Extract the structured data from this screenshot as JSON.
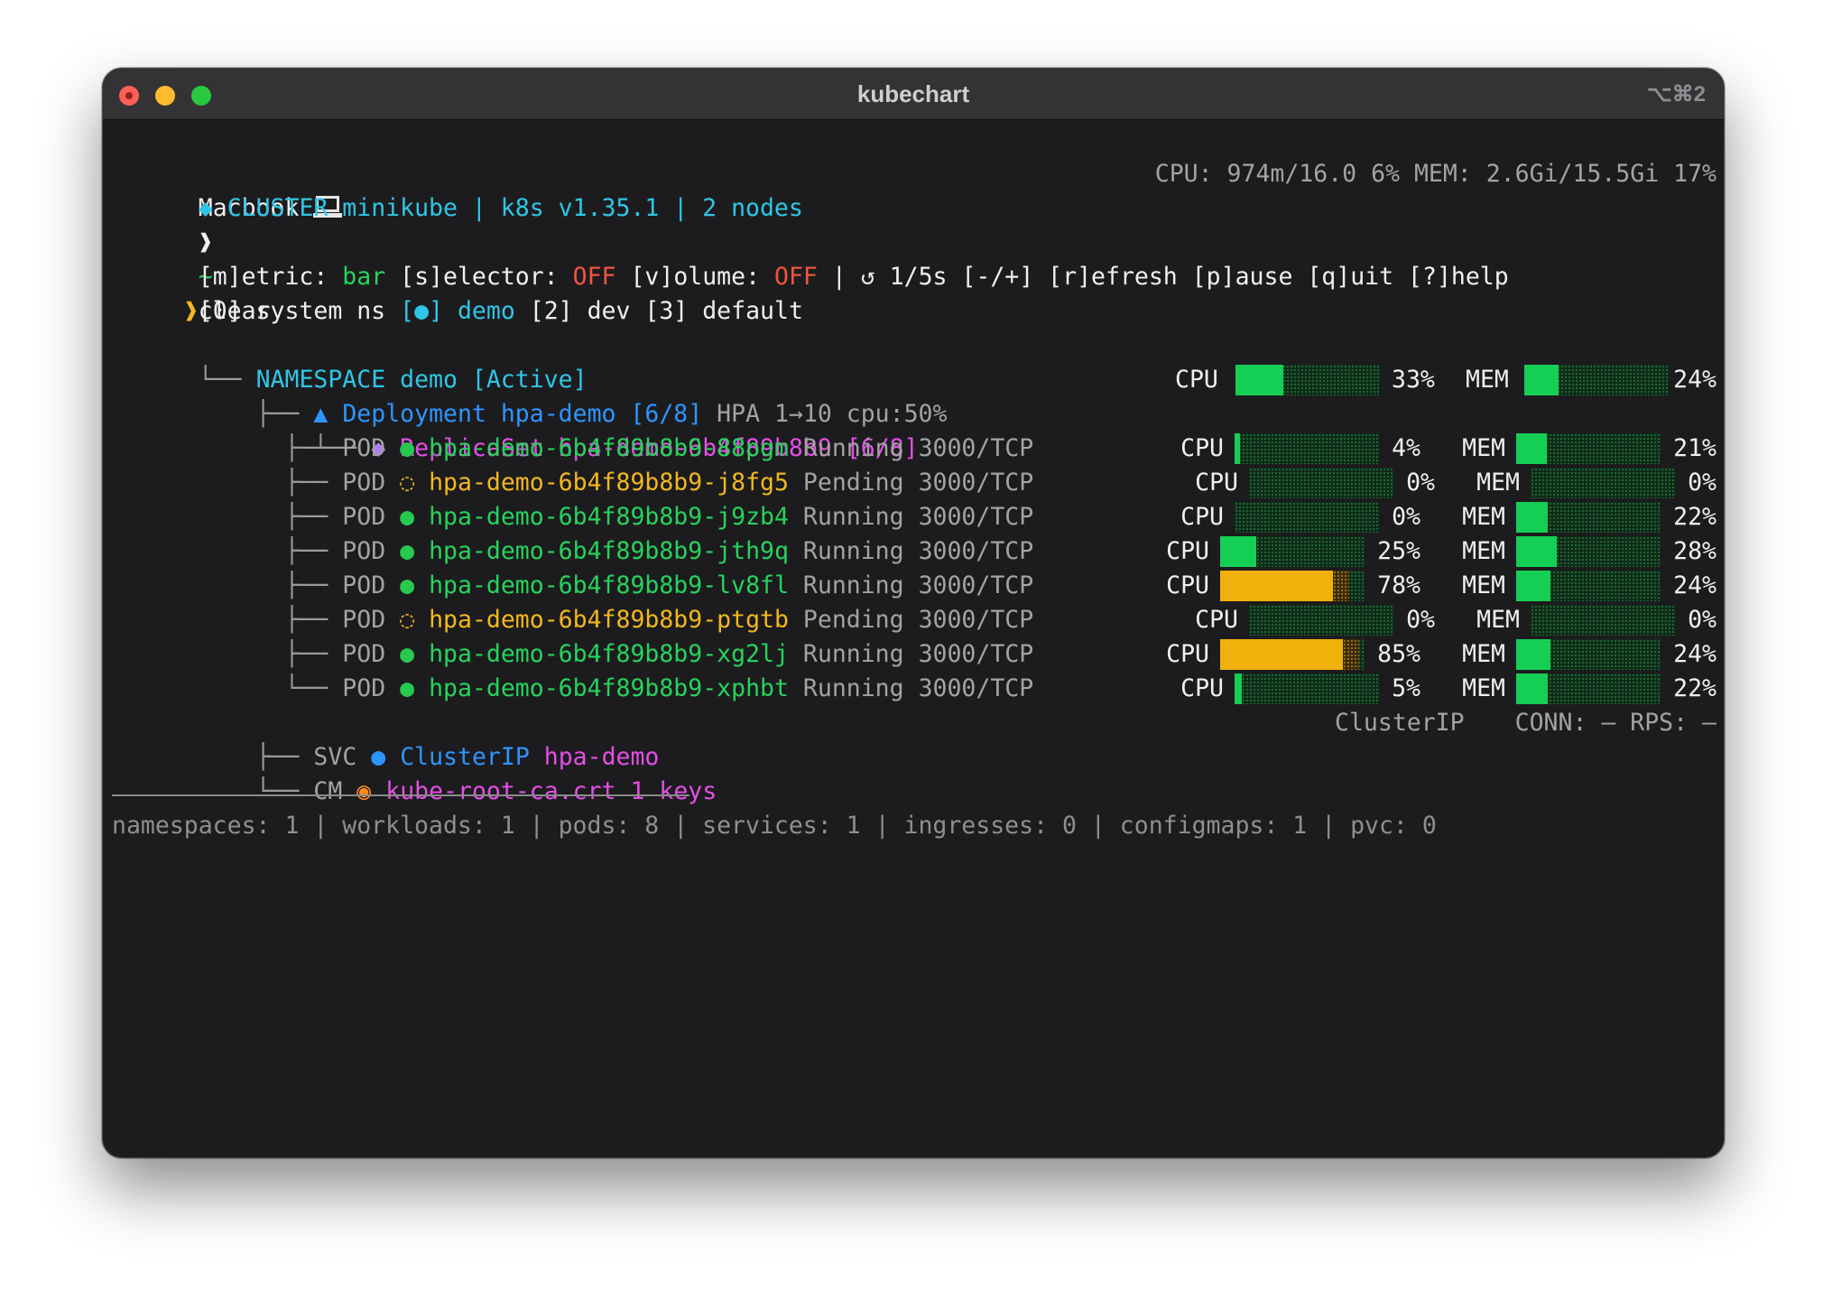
{
  "window": {
    "title": "kubechart",
    "shortcut": "⌥⌘2"
  },
  "prompt": {
    "host": "Macbook",
    "sep1": "❱",
    "dir": "~",
    "sep2": "❱",
    "command": "clear"
  },
  "cluster": {
    "diamond": "◆",
    "text": "CLUSTER minikube | k8s v1.35.1 | 2 nodes",
    "stats": "CPU: 974m/16.0 6% MEM: 2.6Gi/15.5Gi 17%"
  },
  "controls": {
    "metric_key": "[m]etric:",
    "metric_val": "bar",
    "selector_key": "[s]elector:",
    "selector_val": "OFF",
    "volume_key": "[v]olume:",
    "volume_val": "OFF",
    "rest": "| ↺ 1/5s [-/+] [r]efresh [p]ause [q]uit [?]help"
  },
  "ns_selector": {
    "prefix": "[0] system ns",
    "active_bracket": "[●]",
    "active_name": "demo",
    "rest": "[2] dev [3] default"
  },
  "namespace": {
    "tree": "└──",
    "label": "NAMESPACE demo [Active]"
  },
  "deployment": {
    "tree": "├──",
    "icon": "▲",
    "label": "Deployment hpa-demo [6/8]",
    "hpa": "HPA 1→10 cpu:50%",
    "cpu_label": "CPU",
    "cpu_pct": "33%",
    "cpu": 0.33,
    "mem_label": "MEM",
    "mem_pct": "24%",
    "mem": 0.24
  },
  "replicaset": {
    "tree": "└──",
    "icon": "◆",
    "label": "ReplicaSet hpa-demo-6b4f89b8b9 [6/8]"
  },
  "pods": [
    {
      "kind": "POD",
      "status_icon": "●",
      "name": "hpa-demo-6b4f89b8b9-88pgm",
      "status": "Running",
      "port": "3000/TCP",
      "cpu_label": "CPU",
      "cpu_pct": "4%",
      "cpu": 0.04,
      "mem_label": "MEM",
      "mem_pct": "21%",
      "mem": 0.21,
      "state": "running"
    },
    {
      "kind": "POD",
      "status_icon": "◌",
      "name": "hpa-demo-6b4f89b8b9-j8fg5",
      "status": "Pending",
      "port": "3000/TCP",
      "cpu_label": "CPU",
      "cpu_pct": "0%",
      "cpu": 0.0,
      "mem_label": "MEM",
      "mem_pct": "0%",
      "mem": 0.0,
      "state": "pending"
    },
    {
      "kind": "POD",
      "status_icon": "●",
      "name": "hpa-demo-6b4f89b8b9-j9zb4",
      "status": "Running",
      "port": "3000/TCP",
      "cpu_label": "CPU",
      "cpu_pct": "0%",
      "cpu": 0.0,
      "mem_label": "MEM",
      "mem_pct": "22%",
      "mem": 0.22,
      "state": "running"
    },
    {
      "kind": "POD",
      "status_icon": "●",
      "name": "hpa-demo-6b4f89b8b9-jth9q",
      "status": "Running",
      "port": "3000/TCP",
      "cpu_label": "CPU",
      "cpu_pct": "25%",
      "cpu": 0.25,
      "mem_label": "MEM",
      "mem_pct": "28%",
      "mem": 0.28,
      "state": "running"
    },
    {
      "kind": "POD",
      "status_icon": "●",
      "name": "hpa-demo-6b4f89b8b9-lv8fl",
      "status": "Running",
      "port": "3000/TCP",
      "cpu_label": "CPU",
      "cpu_pct": "78%",
      "cpu": 0.78,
      "mem_label": "MEM",
      "mem_pct": "24%",
      "mem": 0.24,
      "state": "running"
    },
    {
      "kind": "POD",
      "status_icon": "◌",
      "name": "hpa-demo-6b4f89b8b9-ptgtb",
      "status": "Pending",
      "port": "3000/TCP",
      "cpu_label": "CPU",
      "cpu_pct": "0%",
      "cpu": 0.0,
      "mem_label": "MEM",
      "mem_pct": "0%",
      "mem": 0.0,
      "state": "pending"
    },
    {
      "kind": "POD",
      "status_icon": "●",
      "name": "hpa-demo-6b4f89b8b9-xg2lj",
      "status": "Running",
      "port": "3000/TCP",
      "cpu_label": "CPU",
      "cpu_pct": "85%",
      "cpu": 0.85,
      "mem_label": "MEM",
      "mem_pct": "24%",
      "mem": 0.24,
      "state": "running"
    },
    {
      "kind": "POD",
      "status_icon": "●",
      "name": "hpa-demo-6b4f89b8b9-xphbt",
      "status": "Running",
      "port": "3000/TCP",
      "cpu_label": "CPU",
      "cpu_pct": "5%",
      "cpu": 0.05,
      "mem_label": "MEM",
      "mem_pct": "22%",
      "mem": 0.22,
      "state": "running"
    }
  ],
  "pod_tree": "├──",
  "pod_tree_last": "└──",
  "service": {
    "tree": "├──",
    "kind": "SVC",
    "icon": "●",
    "type": "ClusterIP",
    "name": "hpa-demo",
    "right_type": "ClusterIP",
    "right_stats": "CONN: — RPS: —"
  },
  "configmap": {
    "tree": "└──",
    "kind": "CM",
    "icon": "◉",
    "label": "kube-root-ca.crt 1 keys"
  },
  "summary": "namespaces: 1 | workloads: 1 | pods: 8 | services: 1 | ingresses: 0 | configmaps: 1 | pvc: 0",
  "colors": {
    "bar_green": "#15cf55",
    "bar_amber": "#f0b20a",
    "running": "#27d35c",
    "pending": "#f3b81d",
    "cluster": "#2fc6e6",
    "deployment": "#2e95ff",
    "replicaset": "#e44fe6",
    "off": "#f0553f"
  }
}
